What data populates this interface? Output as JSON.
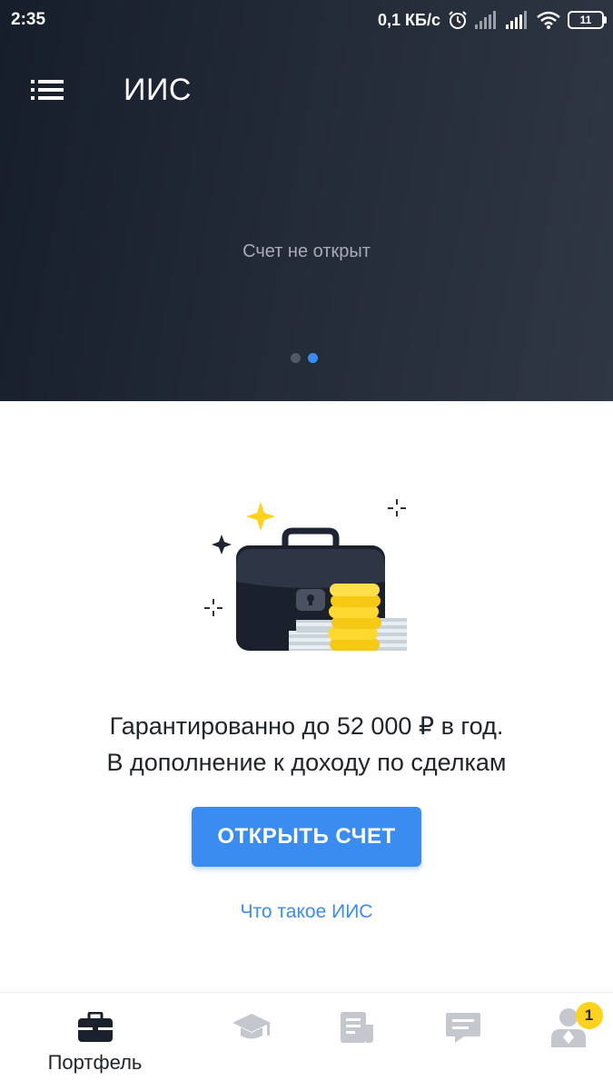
{
  "status_bar": {
    "time": "2:35",
    "network_speed": "0,1 КБ/с",
    "battery_level": "11",
    "icons": [
      "alarm-icon",
      "signal-icon",
      "signal-icon",
      "wifi-icon",
      "battery-icon"
    ]
  },
  "header": {
    "title": "ИИС",
    "menu_icon": "menu-list-icon",
    "account_status": "Счет не открыт",
    "carousel": {
      "pages": 2,
      "active_page": 2
    },
    "colors": {
      "gradient_start": "#161d2b",
      "gradient_end": "#2f3644",
      "active_dot": "#3a8cf0"
    }
  },
  "main": {
    "illustration": "briefcase-coins-money-illustration",
    "promo_line1": "Гарантированно до 52 000 ₽ в год.",
    "promo_line2": "В дополнение к доходу по сделкам",
    "open_account_button": "ОТКРЫТЬ СЧЕТ",
    "what_is_link": "Что такое ИИС",
    "accent_color": "#3a8cf0"
  },
  "tabbar": {
    "tabs": [
      {
        "id": "portfolio",
        "label": "Портфель",
        "icon": "briefcase-icon",
        "active": true
      },
      {
        "id": "learning",
        "label": "",
        "icon": "graduation-cap-icon",
        "active": false
      },
      {
        "id": "news",
        "label": "",
        "icon": "newspaper-icon",
        "active": false
      },
      {
        "id": "chat",
        "label": "",
        "icon": "chat-icon",
        "active": false
      },
      {
        "id": "profile",
        "label": "",
        "icon": "person-icon",
        "active": false,
        "badge": "1"
      }
    ]
  }
}
